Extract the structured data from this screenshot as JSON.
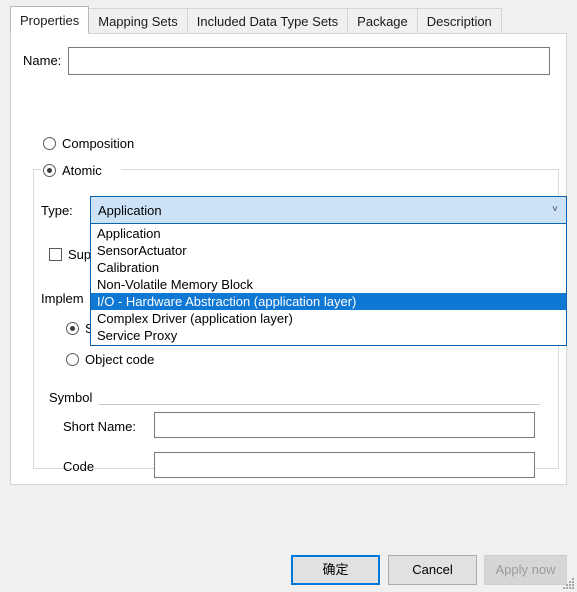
{
  "tabs": [
    {
      "label": "Properties",
      "active": true
    },
    {
      "label": "Mapping Sets",
      "active": false
    },
    {
      "label": "Included Data Type Sets",
      "active": false
    },
    {
      "label": "Package",
      "active": false
    },
    {
      "label": "Description",
      "active": false
    }
  ],
  "form": {
    "name_label": "Name:",
    "name_value": "",
    "name_placeholder": "",
    "composition_label": "Composition",
    "composition_selected": false,
    "atomic_label": "Atomic",
    "atomic_selected": true,
    "type_label": "Type:",
    "type_value": "Application",
    "combo_arrow": "˅",
    "supports_label": "Supp",
    "supports_checked": false,
    "implementation_label": "Implem",
    "source_code_label": "So",
    "source_code_selected": true,
    "object_code_label": "Object code",
    "object_code_selected": false
  },
  "dropdown": {
    "open": true,
    "selected_index": 4,
    "options": [
      "Application",
      "SensorActuator",
      "Calibration",
      "Non-Volatile Memory Block",
      "I/O - Hardware Abstraction (application layer)",
      "Complex Driver (application layer)",
      "Service Proxy"
    ]
  },
  "symbol": {
    "group_label": "Symbol",
    "short_name_label": "Short Name:",
    "short_name_value": "",
    "code_label": "Code",
    "code_value": ""
  },
  "footer": {
    "ok_label": "确定",
    "cancel_label": "Cancel",
    "apply_label": "Apply now",
    "apply_disabled": true
  },
  "colors": {
    "accent": "#0078d7",
    "selection": "#0f77d4",
    "combo_fill": "#cce3f7",
    "combo_border": "#0a62ad",
    "panel_bg": "#ffffff",
    "window_bg": "#f0f0f0",
    "disabled_text": "#9b9b9b"
  }
}
